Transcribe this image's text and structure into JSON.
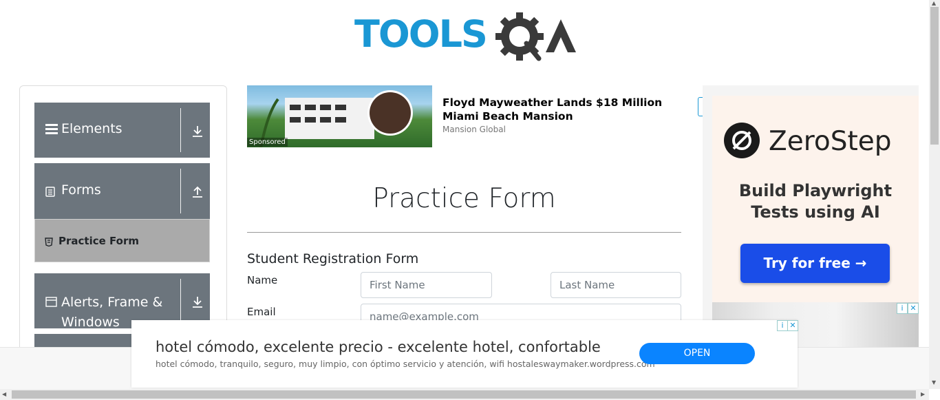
{
  "header": {
    "logo_text": "TOOLS",
    "logo_alt": "TOOLSQA"
  },
  "sidebar": {
    "groups": [
      {
        "label": "Elements",
        "icon": "menu-icon",
        "arrow": "download-arrow-icon"
      },
      {
        "label": "Forms",
        "icon": "document-icon",
        "arrow": "upload-arrow-icon"
      },
      {
        "label": "Alerts, Frame &",
        "label2": "Windows",
        "icon": "window-icon",
        "arrow": "download-arrow-icon"
      }
    ],
    "active_item": {
      "label": "Practice Form",
      "icon": "html5-icon"
    }
  },
  "ad_top": {
    "title": "Floyd Mayweather Lands $18 Million Miami Beach Mansion",
    "source": "Mansion Global",
    "sponsored": "Sponsored"
  },
  "form": {
    "page_title": "Practice Form",
    "subtitle": "Student Registration Form",
    "name_label": "Name",
    "first_name_placeholder": "First Name",
    "last_name_placeholder": "Last Name",
    "email_label": "Email",
    "email_placeholder": "name@example.com"
  },
  "right_ad": {
    "brand": "ZeroStep",
    "tagline_line1": "Build Playwright",
    "tagline_line2": "Tests using AI",
    "cta": "Try for free →"
  },
  "bottom_ad": {
    "title": "hotel cómodo, excelente precio - excelente hotel, confortable",
    "description": "hotel cómodo, tranquilo, seguro, muy limpio, con óptimo servicio y atención, wifi hostaleswaymaker.wordpress.com",
    "open_label": "OPEN"
  },
  "colors": {
    "brand_blue": "#1a97d4",
    "sidebar_gray": "#6c757d",
    "active_gray": "#aaaaaa",
    "cta_blue": "#1a4de8",
    "open_blue": "#0a84ff"
  }
}
